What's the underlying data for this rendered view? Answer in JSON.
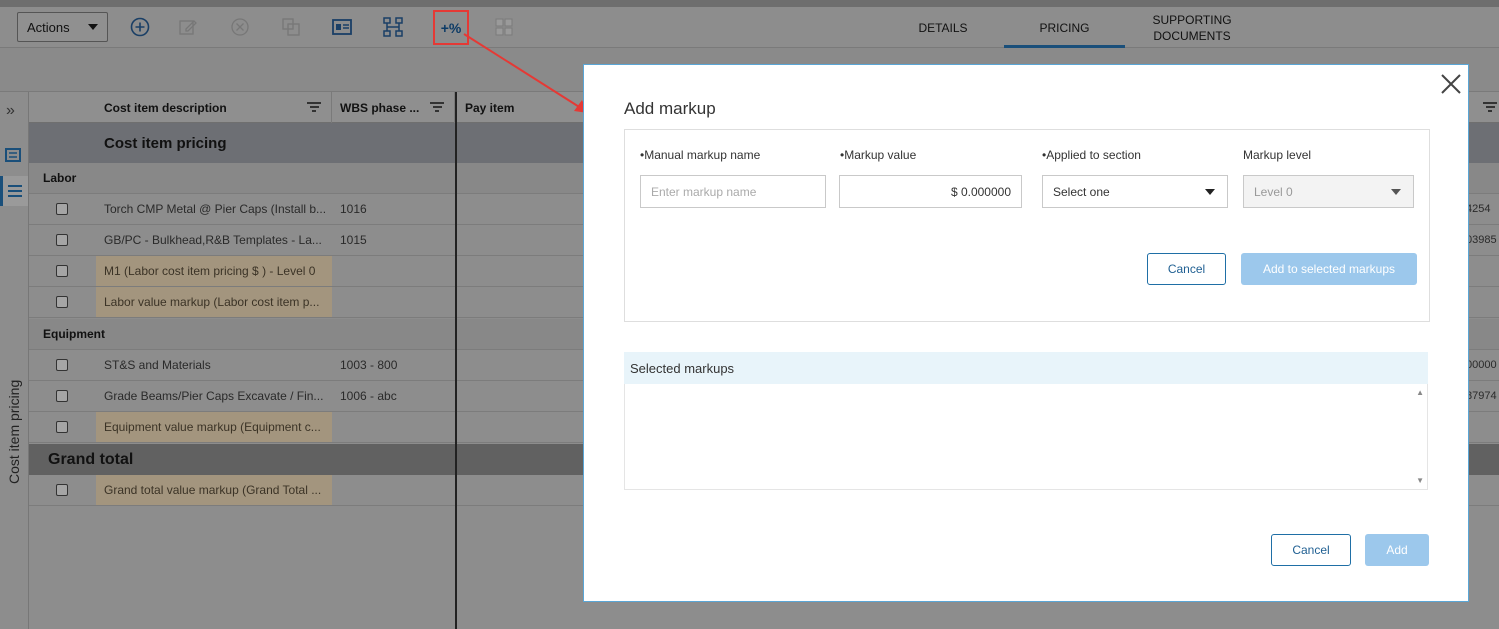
{
  "toolbar": {
    "actions_label": "Actions",
    "markup_icon_text": "+%"
  },
  "tabs": [
    {
      "label": "DETAILS"
    },
    {
      "label": "PRICING"
    },
    {
      "label": "SUPPORTING\nDOCUMENTS"
    }
  ],
  "rail": {
    "vertical_label": "Cost item pricing"
  },
  "grid": {
    "headers": {
      "col1": "Cost item description",
      "col2": "WBS phase ...",
      "col3": "Pay item"
    },
    "section_title": "Cost item pricing",
    "labor_label": "Labor",
    "equipment_label": "Equipment",
    "grand_total_label": "Grand total",
    "rows": [
      {
        "desc": "Torch CMP Metal @ Pier Caps (Install b...",
        "wbs": "1016",
        "edge": "4254"
      },
      {
        "desc": "GB/PC - Bulkhead,R&B Templates - La...",
        "wbs": "1015",
        "edge": "03985"
      },
      {
        "desc": "M1 (Labor cost item pricing $ ) - Level 0",
        "wbs": "",
        "edge": ""
      },
      {
        "desc": "Labor value markup (Labor cost item p...",
        "wbs": "",
        "edge": ""
      },
      {
        "desc": "ST&S and Materials",
        "wbs": "1003 - 800",
        "edge": "00000"
      },
      {
        "desc": "Grade Beams/Pier Caps Excavate / Fin...",
        "wbs": "1006 - abc",
        "edge": "87974"
      },
      {
        "desc": "Equipment value markup (Equipment c...",
        "wbs": "",
        "edge": ""
      },
      {
        "desc": "Grand total value markup (Grand Total ...",
        "wbs": "",
        "edge": ""
      }
    ]
  },
  "modal": {
    "title": "Add markup",
    "fields": {
      "name_label": "Manual markup name",
      "name_placeholder": "Enter markup name",
      "value_label": "Markup value",
      "value": "$ 0.000000",
      "section_label": "Applied to section",
      "section_value": "Select one",
      "level_label": "Markup level",
      "level_value": "Level 0"
    },
    "required_marker": "•",
    "cancel_label": "Cancel",
    "add_selected_label": "Add to selected markups",
    "selected_markups_label": "Selected markups",
    "footer_cancel_label": "Cancel",
    "footer_add_label": "Add"
  },
  "colors": {
    "accent": "#1f6fa6",
    "highlight_box": "#e53935",
    "markup_row": "#a3957e"
  }
}
